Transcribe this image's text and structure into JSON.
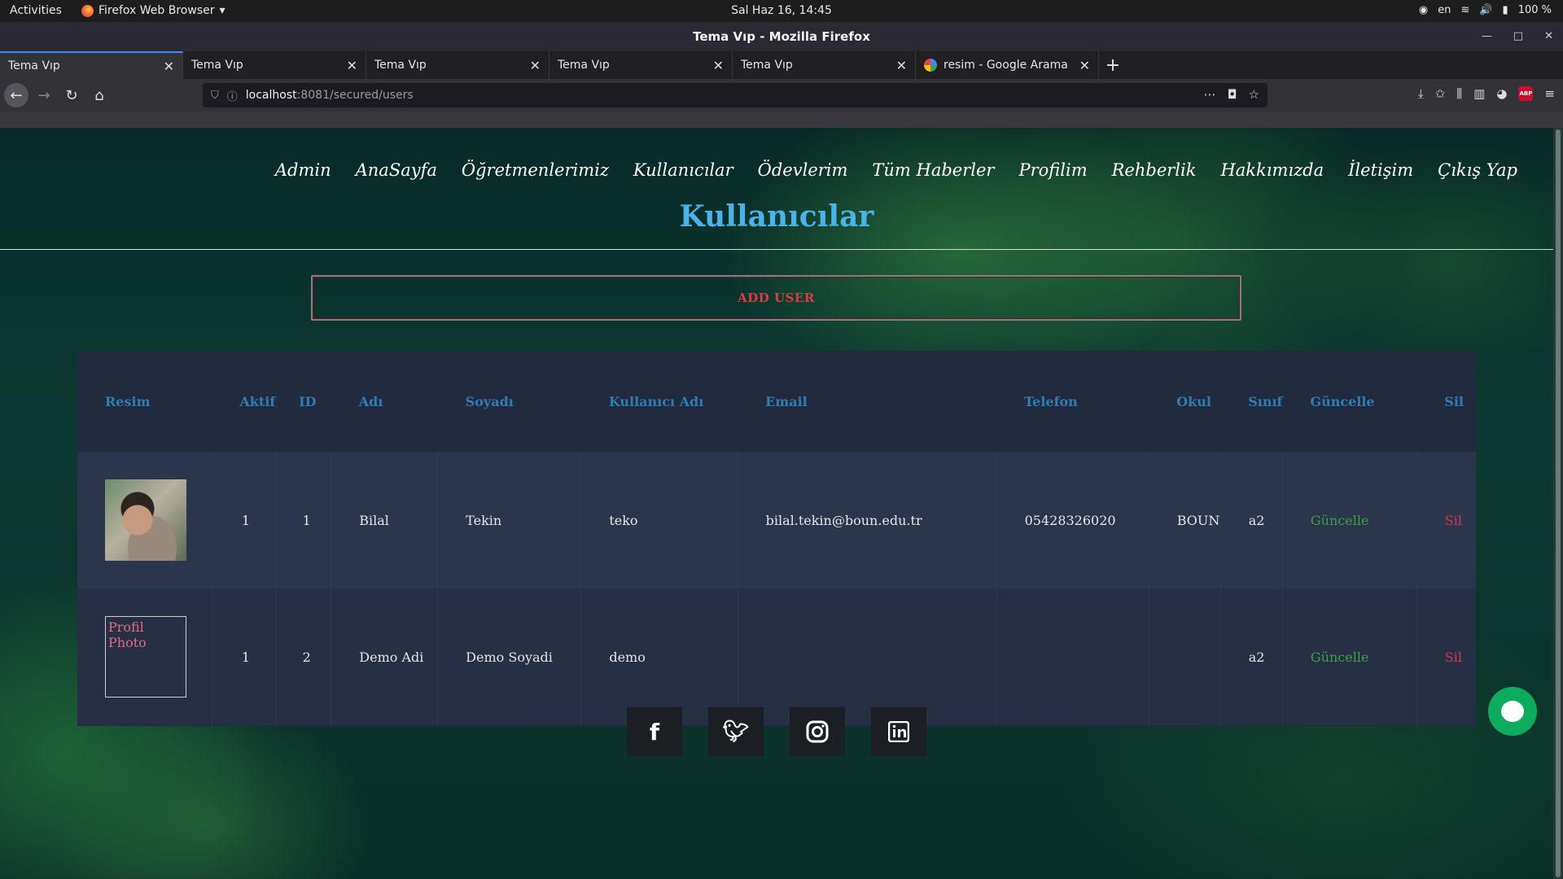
{
  "os": {
    "activities": "Activities",
    "app_name": "Firefox Web Browser",
    "clock": "Sal Haz 16, 14:45",
    "lang": "en",
    "battery": "100 %"
  },
  "window": {
    "title": "Tema Vıp - Mozilla Firefox"
  },
  "tabs": [
    {
      "label": "Tema Vıp"
    },
    {
      "label": "Tema Vıp"
    },
    {
      "label": "Tema Vıp"
    },
    {
      "label": "Tema Vıp"
    },
    {
      "label": "Tema Vıp"
    },
    {
      "label": "resim - Google Arama"
    }
  ],
  "url": {
    "host": "localhost",
    "rest": ":8081/secured/users"
  },
  "menu": [
    "Admin",
    "AnaSayfa",
    "Öğretmenlerimiz",
    "Kullanıcılar",
    "Ödevlerim",
    "Tüm Haberler",
    "Profilim",
    "Rehberlik",
    "Hakkımızda",
    "İletişim",
    "Çıkış Yap"
  ],
  "page": {
    "title": "Kullanıcılar",
    "add_button": "ADD USER"
  },
  "table": {
    "headers": [
      "Resim",
      "Aktif",
      "ID",
      "Adı",
      "Soyadı",
      "Kullanıcı Adı",
      "Email",
      "Telefon",
      "Okul",
      "Sınıf",
      "Güncelle",
      "Sil"
    ],
    "rows": [
      {
        "photo": "",
        "aktif": "1",
        "id": "1",
        "adi": "Bilal",
        "soyadi": "Tekin",
        "kullanici": "teko",
        "email": "bilal.tekin@boun.edu.tr",
        "telefon": "05428326020",
        "okul": "BOUN",
        "sinif": "a2",
        "guncelle": "Güncelle",
        "sil": "Sil"
      },
      {
        "photo": "Profil Photo",
        "aktif": "1",
        "id": "2",
        "adi": "Demo Adi",
        "soyadi": "Demo Soyadi",
        "kullanici": "demo",
        "email": "",
        "telefon": "",
        "okul": "",
        "sinif": "a2",
        "guncelle": "Güncelle",
        "sil": "Sil"
      }
    ]
  },
  "social": [
    "facebook-icon",
    "twitter-icon",
    "instagram-icon",
    "linkedin-icon"
  ]
}
